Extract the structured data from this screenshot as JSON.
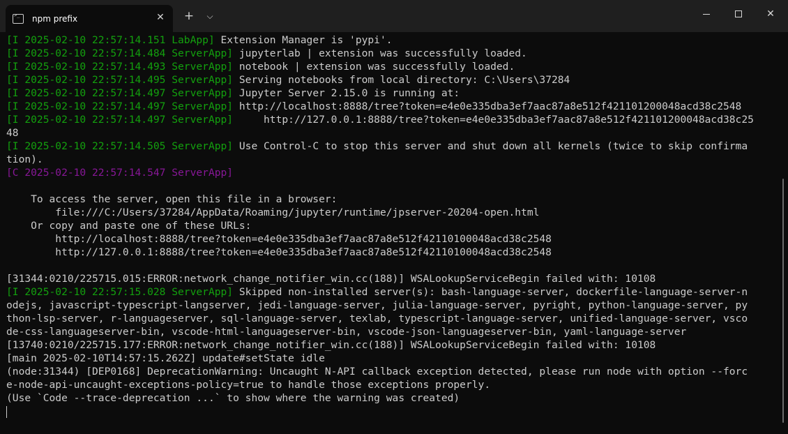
{
  "titlebar": {
    "tab_title": "npm prefix",
    "tab_close": "✕",
    "new_tab": "+",
    "dropdown": "⌵",
    "close_symbol": "✕"
  },
  "terminal": {
    "lines": [
      {
        "prefix": "[I 2025-02-10 22:57:14.151 LabApp]",
        "text": " Extension Manager is 'pypi'."
      },
      {
        "prefix": "[I 2025-02-10 22:57:14.484 ServerApp]",
        "text": " jupyterlab | extension was successfully loaded."
      },
      {
        "prefix": "[I 2025-02-10 22:57:14.493 ServerApp]",
        "text": " notebook | extension was successfully loaded."
      },
      {
        "prefix": "[I 2025-02-10 22:57:14.495 ServerApp]",
        "text": " Serving notebooks from local directory: C:\\Users\\37284"
      },
      {
        "prefix": "[I 2025-02-10 22:57:14.497 ServerApp]",
        "text": " Jupyter Server 2.15.0 is running at:"
      },
      {
        "prefix": "[I 2025-02-10 22:57:14.497 ServerApp]",
        "text": " http://localhost:8888/tree?token=e4e0e335dba3ef7aac87a8e512f421101200048acd38c2548"
      },
      {
        "prefix": "[I 2025-02-10 22:57:14.497 ServerApp]",
        "text": "     http://127.0.0.1:8888/tree?token=e4e0e335dba3ef7aac87a8e512f421101200048acd38c25"
      },
      {
        "prefix": "",
        "text": "48"
      },
      {
        "prefix": "[I 2025-02-10 22:57:14.505 ServerApp]",
        "text": " Use Control-C to stop this server and shut down all kernels (twice to skip confirma"
      },
      {
        "prefix": "",
        "text": "tion)."
      },
      {
        "prefix": "[C 2025-02-10 22:57:14.547 ServerApp]",
        "text": "",
        "prefix_color": "purple"
      },
      {
        "prefix": "",
        "text": ""
      },
      {
        "prefix": "",
        "text": "    To access the server, open this file in a browser:"
      },
      {
        "prefix": "",
        "text": "        file:///C:/Users/37284/AppData/Roaming/jupyter/runtime/jpserver-20204-open.html"
      },
      {
        "prefix": "",
        "text": "    Or copy and paste one of these URLs:"
      },
      {
        "prefix": "",
        "text": "        http://localhost:8888/tree?token=e4e0e335dba3ef7aac87a8e512f42110100048acd38c2548"
      },
      {
        "prefix": "",
        "text": "        http://127.0.0.1:8888/tree?token=e4e0e335dba3ef7aac87a8e512f42110100048acd38c2548"
      },
      {
        "prefix": "",
        "text": ""
      },
      {
        "prefix": "",
        "text": "[31344:0210/225715.015:ERROR:network_change_notifier_win.cc(188)] WSALookupServiceBegin failed with: 10108"
      },
      {
        "prefix": "[I 2025-02-10 22:57:15.028 ServerApp]",
        "text": " Skipped non-installed server(s): bash-language-server, dockerfile-language-server-n"
      },
      {
        "prefix": "",
        "text": "odejs, javascript-typescript-langserver, jedi-language-server, julia-language-server, pyright, python-language-server, py"
      },
      {
        "prefix": "",
        "text": "thon-lsp-server, r-languageserver, sql-language-server, texlab, typescript-language-server, unified-language-server, vsco"
      },
      {
        "prefix": "",
        "text": "de-css-languageserver-bin, vscode-html-languageserver-bin, vscode-json-languageserver-bin, yaml-language-server"
      },
      {
        "prefix": "",
        "text": "[13740:0210/225715.177:ERROR:network_change_notifier_win.cc(188)] WSALookupServiceBegin failed with: 10108"
      },
      {
        "prefix": "",
        "text": "[main 2025-02-10T14:57:15.262Z] update#setState idle"
      },
      {
        "prefix": "",
        "text": "(node:31344) [DEP0168] DeprecationWarning: Uncaught N-API callback exception detected, please run node with option --forc"
      },
      {
        "prefix": "",
        "text": "e-node-api-uncaught-exceptions-policy=true to handle those exceptions properly."
      },
      {
        "prefix": "",
        "text": "(Use `Code --trace-deprecation ...` to show where the warning was created)"
      }
    ]
  },
  "colors": {
    "background": "#0c0c0c",
    "titlebar": "#1f1f1f",
    "text": "#cccccc",
    "timestamp_green": "#13a10e",
    "timestamp_purple": "#881798"
  }
}
